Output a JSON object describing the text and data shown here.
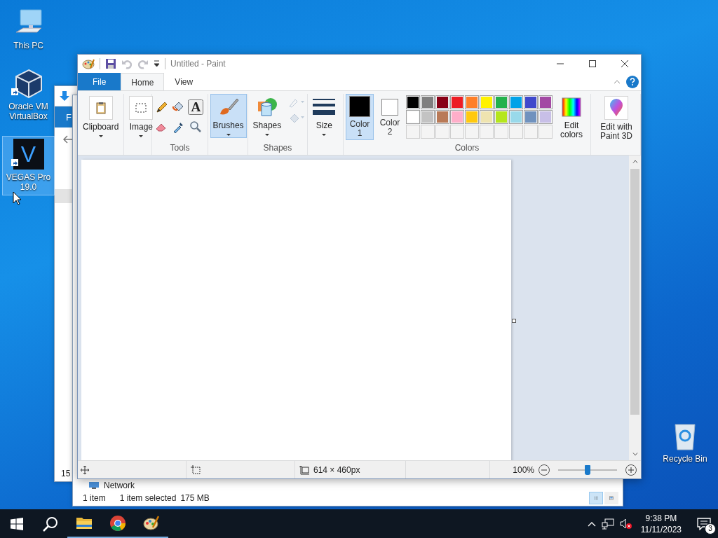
{
  "desktop": {
    "icons": [
      {
        "kind": "computer",
        "label": "This PC",
        "selected": false
      },
      {
        "kind": "cube",
        "label": "Oracle VM VirtualBox",
        "selected": false,
        "shortcut": true
      },
      {
        "kind": "logo",
        "glyph": "V",
        "label": "VEGAS Pro 19.0",
        "selected": true,
        "shortcut": true
      }
    ],
    "recycle_bin": {
      "label": "Recycle Bin"
    }
  },
  "back_windows": {
    "tab_letter": "F",
    "row_number": "15",
    "network_label": "Network",
    "status": {
      "items": "1 item",
      "selection": "1 item selected",
      "size": "175 MB"
    }
  },
  "paint": {
    "title": "Untitled - Paint",
    "quick_access": [
      {
        "kind": "save",
        "disabled": false
      },
      {
        "kind": "undo",
        "disabled": true
      },
      {
        "kind": "redo",
        "disabled": true
      }
    ],
    "tabs": [
      {
        "label": "File",
        "kind": "file",
        "selected": false
      },
      {
        "label": "Home",
        "kind": "tab",
        "selected": true
      },
      {
        "label": "View",
        "kind": "tab",
        "selected": false
      }
    ],
    "ribbon": {
      "clipboard": {
        "label": "Clipboard"
      },
      "image": {
        "label": "Image"
      },
      "tools": {
        "group_label": "Tools",
        "items": [
          {
            "kind": "pencil"
          },
          {
            "kind": "fill"
          },
          {
            "kind": "text",
            "glyph": "A"
          },
          {
            "kind": "eraser"
          },
          {
            "kind": "picker"
          },
          {
            "kind": "magnifier"
          }
        ]
      },
      "brushes": {
        "label": "Brushes",
        "selected": true
      },
      "shapes": {
        "label": "Shapes",
        "group_label": "Shapes",
        "outline": {
          "disabled": true
        },
        "fill": {
          "disabled": true
        }
      },
      "size": {
        "label": "Size"
      },
      "colors": {
        "group_label": "Colors",
        "slots": [
          {
            "label": "Color 1",
            "color": "#000000",
            "selected": true
          },
          {
            "label": "Color 2",
            "color": "#ffffff",
            "selected": false
          }
        ],
        "palette": [
          {
            "swatches": [
              {
                "color": "#000000"
              },
              {
                "color": "#7f7f7f"
              },
              {
                "color": "#880015"
              },
              {
                "color": "#ed1c24"
              },
              {
                "color": "#ff7f27"
              },
              {
                "color": "#fff200"
              },
              {
                "color": "#22b14c"
              },
              {
                "color": "#00a2e8"
              },
              {
                "color": "#3f48cc"
              },
              {
                "color": "#a349a4"
              }
            ]
          },
          {
            "swatches": [
              {
                "color": "#ffffff"
              },
              {
                "color": "#c3c3c3"
              },
              {
                "color": "#b97a57"
              },
              {
                "color": "#ffaec9"
              },
              {
                "color": "#ffc90e"
              },
              {
                "color": "#efe4b0"
              },
              {
                "color": "#b5e61d"
              },
              {
                "color": "#99d9ea"
              },
              {
                "color": "#7092be"
              },
              {
                "color": "#c8bfe7"
              }
            ]
          },
          {
            "swatches": [
              {
                "kind": "empty"
              },
              {
                "kind": "empty"
              },
              {
                "kind": "empty"
              },
              {
                "kind": "empty"
              },
              {
                "kind": "empty"
              },
              {
                "kind": "empty"
              },
              {
                "kind": "empty"
              },
              {
                "kind": "empty"
              },
              {
                "kind": "empty"
              },
              {
                "kind": "empty"
              }
            ]
          }
        ],
        "edit_colors": {
          "label": "Edit colors"
        }
      },
      "paint3d": {
        "label": "Edit with Paint 3D"
      }
    },
    "status_bar": {
      "dimensions": "614 × 460px",
      "zoom": "100%",
      "zoom_slider": {
        "level": 0.5
      }
    }
  },
  "taskbar": {
    "apps": [
      {
        "kind": "folder",
        "running": true
      },
      {
        "kind": "browser",
        "running": true
      },
      {
        "kind": "palette",
        "running": true
      }
    ],
    "tray": {
      "time": "9:38 PM",
      "date": "11/11/2023",
      "notifications": "3"
    }
  }
}
